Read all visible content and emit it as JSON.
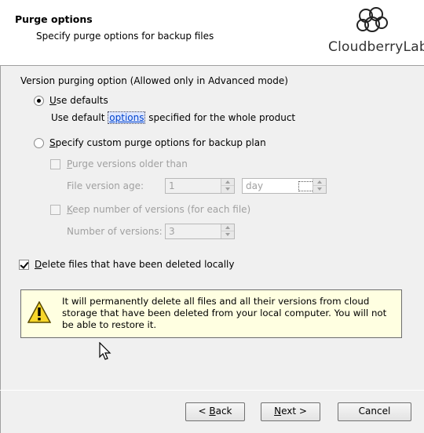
{
  "header": {
    "title": "Purge options",
    "subtitle": "Specify purge options for backup files",
    "logo_text": "CloudberryLab"
  },
  "group": {
    "label": "Version purging option (Allowed only in Advanced mode)"
  },
  "options": {
    "use_defaults": {
      "label_first": "U",
      "label_rest": "se defaults",
      "selected": true
    },
    "defaults_desc_before": "Use default ",
    "defaults_link": "options",
    "defaults_desc_after": " specified for the whole product",
    "custom": {
      "label_first": "S",
      "label_rest": "pecify custom purge options for backup plan",
      "selected": false
    }
  },
  "purge_older": {
    "label_first": "P",
    "label_rest": "urge versions older than",
    "checked": false,
    "age_label": "File version age:",
    "age_value": "1",
    "unit_value": "day"
  },
  "keep_versions": {
    "label_first": "K",
    "label_rest": "eep number of versions (for each file)",
    "checked": false,
    "count_label": "Number of versions:",
    "count_value": "3"
  },
  "delete_local": {
    "label_first": "D",
    "label_rest": "elete files that have been deleted locally",
    "checked": true
  },
  "warning": {
    "text": "It will permanently delete all files and all their versions from cloud storage that have been deleted from your local computer. You will not be able to restore it."
  },
  "footer": {
    "back_prefix": "< ",
    "back_key": "B",
    "back_rest": "ack",
    "next_key": "N",
    "next_rest": "ext >",
    "cancel": "Cancel"
  }
}
